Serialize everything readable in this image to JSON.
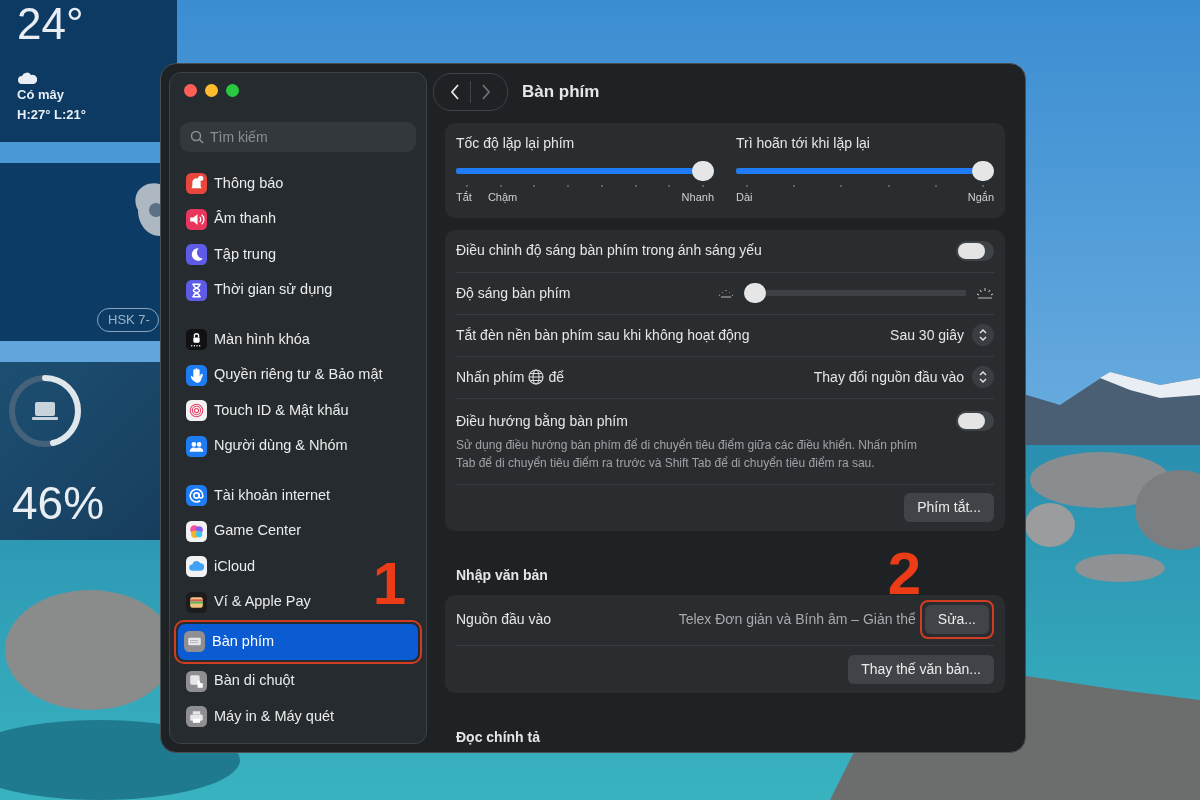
{
  "desktop": {
    "weather_widget": {
      "temperature": "24°",
      "condition": "Có mây",
      "range": "H:27° L:21°"
    },
    "app_widget": {
      "tag": "HSK 7-"
    },
    "battery_widget": {
      "level": 0.46,
      "percent": "46%"
    }
  },
  "window": {
    "sidebar": {
      "search": {
        "placeholder": "Tìm kiếm"
      },
      "groups": [
        {
          "items": [
            {
              "label": "Thông báo",
              "color": "#e8453c",
              "selected": false
            },
            {
              "label": "Âm thanh",
              "color": "#e8365d",
              "selected": false
            },
            {
              "label": "Tập trung",
              "color": "#5e5ce6",
              "selected": false
            },
            {
              "label": "Thời gian sử dụng",
              "color": "#5e5ce6",
              "selected": false
            }
          ]
        },
        {
          "items": [
            {
              "label": "Màn hình khóa",
              "color": "#111113",
              "selected": false
            },
            {
              "label": "Quyền riêng tư & Bảo mật",
              "color": "#1e7cf2",
              "selected": false
            },
            {
              "label": "Touch ID & Mật khẩu",
              "color": "#f2f2f2",
              "selected": false
            },
            {
              "label": "Người dùng & Nhóm",
              "color": "#1e7cf2",
              "selected": false
            }
          ]
        },
        {
          "items": [
            {
              "label": "Tài khoản internet",
              "color": "#1e7cf2",
              "selected": false
            },
            {
              "label": "Game Center",
              "color": "#f2f2f2",
              "selected": false
            },
            {
              "label": "iCloud",
              "color": "#f2f2f2",
              "selected": false
            },
            {
              "label": "Ví & Apple Pay",
              "color": "#1c1c1e",
              "selected": false
            },
            {
              "label": "Bàn phím",
              "color": "#8e8e93",
              "selected": true,
              "callout": "1"
            },
            {
              "label": "Bàn di chuột",
              "color": "#8e8e93",
              "selected": false
            },
            {
              "label": "Máy in & Máy quét",
              "color": "#8e8e93",
              "selected": false
            }
          ]
        }
      ]
    },
    "nav": [
      {
        "kind": "back",
        "disabled": false
      },
      {
        "kind": "forward",
        "disabled": true
      }
    ],
    "title": "Bàn phím",
    "repeat_sliders": [
      {
        "label": "Tốc độ lặp lại phím",
        "level": 1,
        "min_label": "Tắt",
        "second_label": "Chậm",
        "max_label": "Nhanh"
      },
      {
        "label": "Trì hoãn tới khi lặp lại",
        "level": 1,
        "min_label": "Dài",
        "max_label": "Ngắn"
      }
    ],
    "settings": [
      {
        "kind": "toggle",
        "label": "Điều chỉnh độ sáng bàn phím trong ánh sáng yếu",
        "on": false
      },
      {
        "kind": "slider",
        "label": "Độ sáng bàn phím",
        "level": 0
      },
      {
        "kind": "select",
        "label": "Tắt đèn nền bàn phím sau khi không hoạt động",
        "value": "Sau 30 giây"
      },
      {
        "kind": "select",
        "label": "Nhấn phím",
        "label_after": "để",
        "value": "Thay đổi nguồn đầu vào"
      },
      {
        "kind": "toggle",
        "label": "Điều hướng bằng bàn phím",
        "on": false,
        "description": "Sử dụng điều hướng bàn phím để di chuyển tiêu điểm giữa các điều khiển. Nhấn phím Tab để di chuyển tiêu điểm ra trước và Shift Tab để di chuyển tiêu điểm ra sau."
      },
      {
        "kind": "button",
        "button": "Phím tắt..."
      }
    ],
    "text_input": {
      "heading": "Nhập văn bản",
      "rows": [
        {
          "kind": "source",
          "label": "Nguồn đầu vào",
          "value": "Telex Đơn giản và Bính âm – Giản thể",
          "button": "Sửa...",
          "callout": "2"
        },
        {
          "kind": "button",
          "button": "Thay thế văn bản..."
        }
      ]
    },
    "next_heading": "Đọc chính tả"
  }
}
